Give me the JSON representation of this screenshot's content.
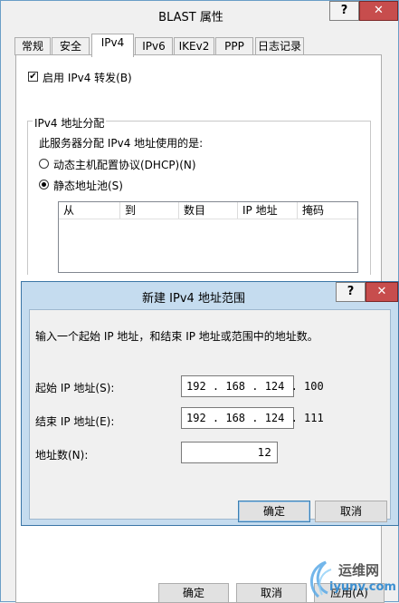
{
  "outer": {
    "title": "BLAST 属性",
    "help_label": "?",
    "close_label": "✕",
    "tabs": [
      "常规",
      "安全",
      "IPv4",
      "IPv6",
      "IKEv2",
      "PPP",
      "日志记录"
    ],
    "enable_forward_label": "启用 IPv4 转发(B)",
    "group_title": "IPv4 地址分配",
    "group_desc": "此服务器分配 IPv4 地址使用的是:",
    "dhcp_label": "动态主机配置协议(DHCP)(N)",
    "static_label": "静态地址池(S)",
    "columns": [
      "从",
      "到",
      "数目",
      "IP 地址",
      "掩码"
    ],
    "ok_label": "确定",
    "cancel_label": "取消",
    "apply_label": "应用(A)"
  },
  "dialog": {
    "title": "新建 IPv4 地址范围",
    "help_label": "?",
    "close_label": "✕",
    "instruction": "输入一个起始 IP 地址，和结束 IP 地址或范围中的地址数。",
    "start_label": "起始 IP 地址(S):",
    "start_value": "192 . 168 . 124 . 100",
    "end_label": "结束 IP 地址(E):",
    "end_value": "192 . 168 . 124 . 111",
    "count_label": "地址数(N):",
    "count_value": "12",
    "ok_label": "确定",
    "cancel_label": "取消"
  },
  "watermark": {
    "line1": "运维网",
    "line2": "iyunv.com"
  },
  "colors": {
    "close_red": "#c74d4d",
    "dialog_frame": "#c5dcef",
    "focus_blue": "#3c7fb1"
  }
}
